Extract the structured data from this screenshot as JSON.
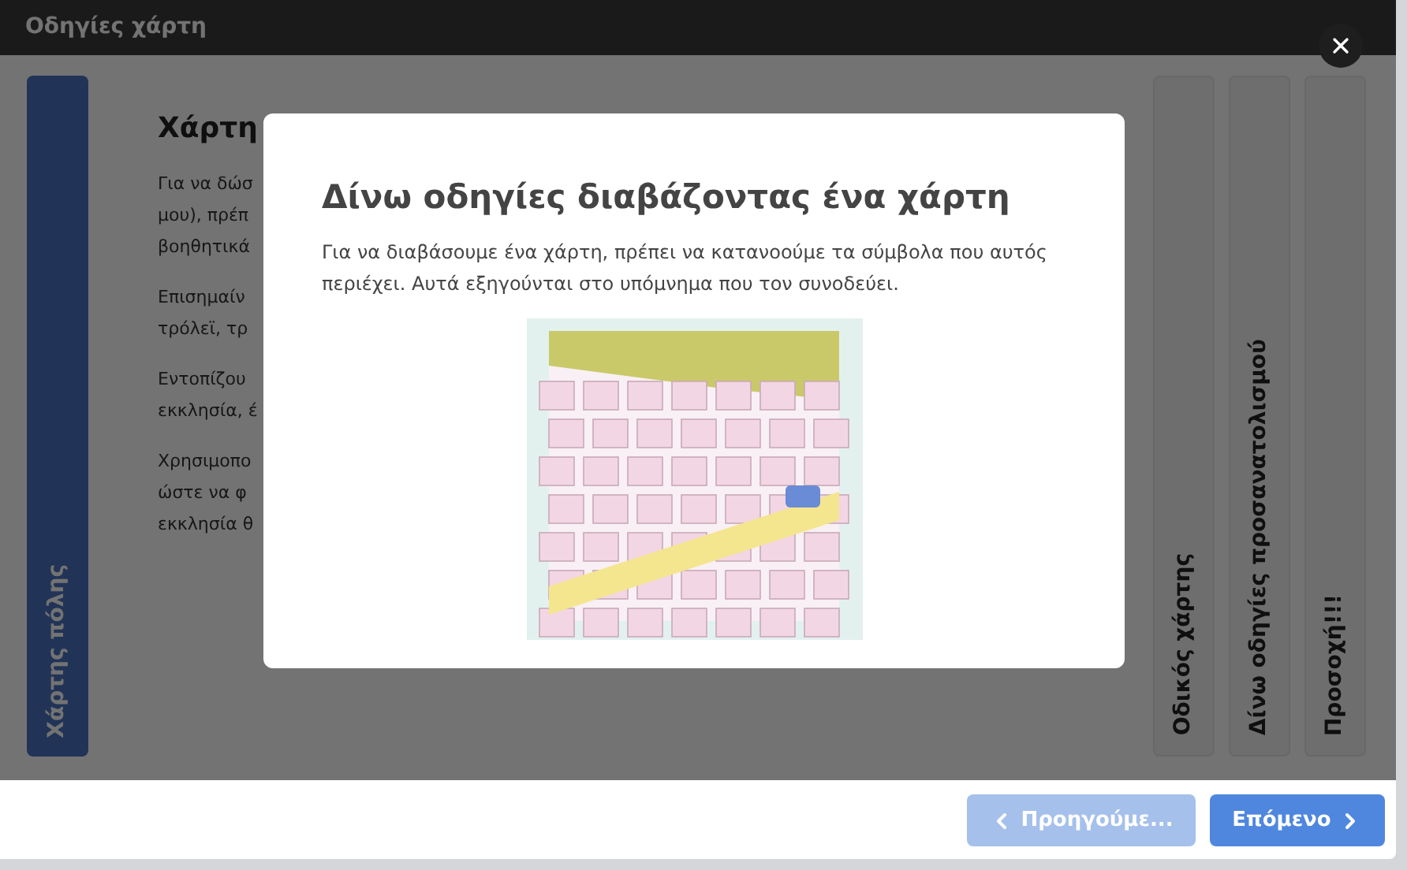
{
  "window": {
    "title": "Οδηγίες χάρτη"
  },
  "panels": [
    {
      "label": "Χάρτης πόλης",
      "selected": true
    },
    {
      "label": "Οδικός χάρτης",
      "selected": false
    },
    {
      "label": "Δίνω οδηγίες προσανατολισμού",
      "selected": false
    },
    {
      "label": "Προσοχή!!!",
      "selected": false
    }
  ],
  "background_content": {
    "heading": "Χάρτη",
    "paragraphs": [
      [
        "Για να δώσ",
        "μου), πρέπ",
        "βοηθητικά"
      ],
      [
        "Επισημαίν",
        "τρόλεϊ, τρ"
      ],
      [
        "Εντοπίζου",
        "εκκλησία, έ"
      ],
      [
        "Χρησιμοπο",
        "ώστε να φ",
        "εκκλησία θ"
      ]
    ]
  },
  "modal": {
    "title": "Δίνω οδηγίες διαβάζοντας ένα χάρτη",
    "text": "Για να διαβάσουμε ένα χάρτη, πρέπει να κατανοούμε τα σύμβολα που αυτός περιέχει. Αυτά εξηγούνται στο υπόμνημα που τον συνοδεύει."
  },
  "footer": {
    "buttons": [
      {
        "kind": "previous",
        "label": "Προηγούμε...",
        "disabled": true
      },
      {
        "kind": "next",
        "label": "Επόμενο",
        "disabled": false
      }
    ]
  }
}
